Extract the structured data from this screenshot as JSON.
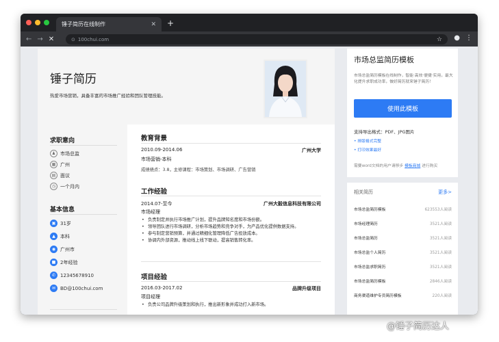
{
  "browser": {
    "tab_title": "锤子简历在线制作",
    "tab_close": "✕",
    "new_tab": "+",
    "url": "100chui.com",
    "dot_colors": [
      "#ff5f57",
      "#febc2e",
      "#28c840"
    ]
  },
  "resume": {
    "name": "锤子简历",
    "tagline": "热爱市场营销，具备丰富的市场推广经验和团队管理技能。",
    "intent": {
      "title": "求职意向",
      "items": [
        "市场总监",
        "广州",
        "面议",
        "一个月内"
      ]
    },
    "basic": {
      "title": "基本信息",
      "items": [
        "31岁",
        "本科",
        "广州市",
        "2年经验",
        "12345678910",
        "BD@100chui.com"
      ]
    },
    "education": {
      "title": "教育背景",
      "period": "2010.09-2014.06",
      "school": "广州大学",
      "major": "市场营销-本科",
      "detail": "成绩绩点：3.8，主修课程：市场策划、市场调研、广告营销"
    },
    "work": {
      "title": "工作经验",
      "period": "2014.07-至今",
      "company": "广州大毅信息科技有限公司",
      "role": "市场经理",
      "bullets": [
        "负责制定并执行市场推广计划，提升品牌知名度和市场份额。",
        "领导团队进行市场调研，分析市场趋势和竞争对手，为产品优化提供数据支持。",
        "参与制定营销预算，并通过精细化管理降低广告投放成本。",
        "协调内外部资源，推动线上线下联动，提高销售转化率。"
      ]
    },
    "project": {
      "title": "项目经验",
      "period": "2016.03-2017.02",
      "name": "品牌升级项目",
      "role": "项目经理",
      "bullets": [
        "负责公司品牌升级策划和执行，推出新形象并成功打入新市场。"
      ]
    }
  },
  "sidebar": {
    "title": "市场总监简历模板",
    "desc": "市场总监简历模板在线制作，智能·高效·便捷·实用，最大化提升求职成功率，做好简历就来锤子简历！",
    "use_button": "使用此模板",
    "formats": "支持导出格式：PDF、JPG图片",
    "format_items": [
      "• 排版格式完整",
      "• 打印效果最好"
    ],
    "note_prefix": "需要word文档的用户请移步",
    "note_link": "模板商城",
    "note_suffix": "进行购买",
    "related_title": "相关简历",
    "related_more": "更多>",
    "related": [
      {
        "name": "市场总监简历模板",
        "count": "623553人阅读"
      },
      {
        "name": "市场经理简历",
        "count": "3521人阅读"
      },
      {
        "name": "市场总监简历",
        "count": "3521人阅读"
      },
      {
        "name": "市场总监个人简历",
        "count": "3521人阅读"
      },
      {
        "name": "市场总监求职简历",
        "count": "3521人阅读"
      },
      {
        "name": "市场总监简历模板",
        "count": "2846人阅读"
      },
      {
        "name": "商务渠道维护专员简历模板",
        "count": "220人阅读"
      }
    ]
  },
  "watermark": "@锤子简历达人"
}
